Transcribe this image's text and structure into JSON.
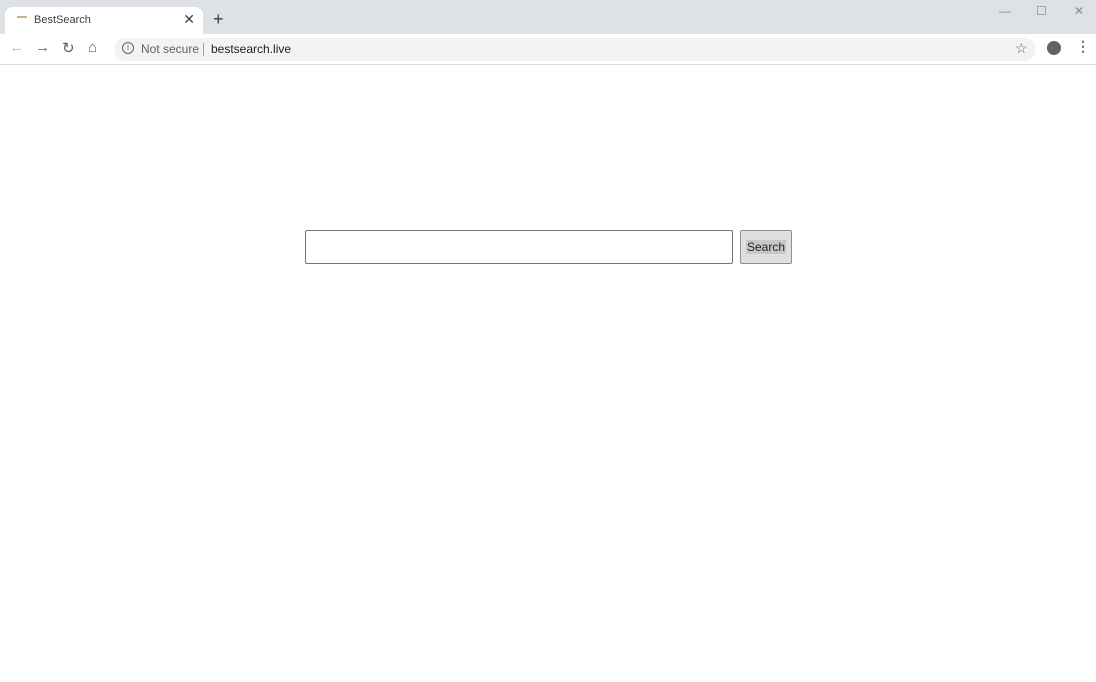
{
  "browser": {
    "tab": {
      "title": "BestSearch",
      "close": "✕"
    },
    "new_tab": "+",
    "window": {
      "minimize": "—",
      "maximize": "☐",
      "close": "✕"
    },
    "nav": {
      "back": "←",
      "forward": "→",
      "reload": "↻",
      "home": "⌂"
    },
    "omnibox": {
      "security": "Not secure",
      "url": "bestsearch.live"
    },
    "star": "☆",
    "menu": "⋮"
  },
  "page": {
    "search_value": "",
    "search_button": "Search"
  }
}
